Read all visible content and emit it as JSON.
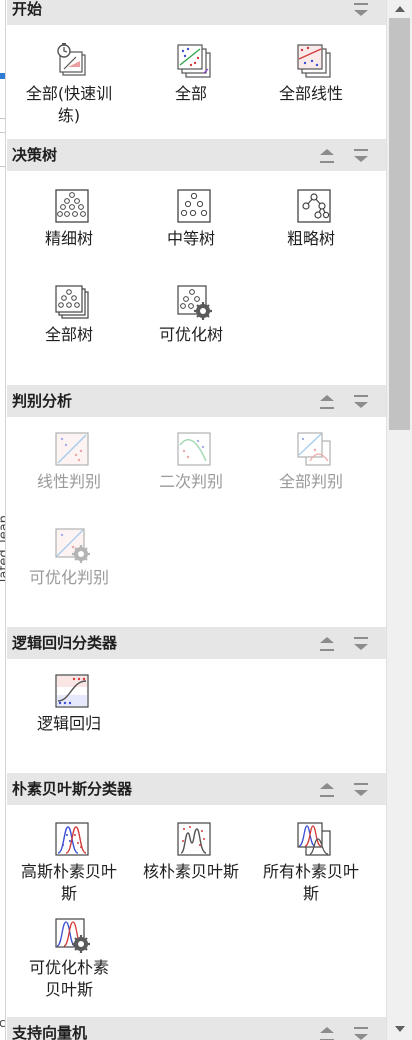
{
  "left_edge": {
    "vertical_text": "lated_lean",
    "bottom_char": "c"
  },
  "sections": [
    {
      "key": "start",
      "title": "开始",
      "tiles": [
        {
          "label": "全部(快速训练)",
          "icon": "fast-train-icon",
          "disabled": false
        },
        {
          "label": "全部",
          "icon": "all-models-icon",
          "disabled": false
        },
        {
          "label": "全部线性",
          "icon": "all-linear-icon",
          "disabled": false
        }
      ]
    },
    {
      "key": "tree",
      "title": "决策树",
      "tiles": [
        {
          "label": "精细树",
          "icon": "fine-tree-icon",
          "disabled": false
        },
        {
          "label": "中等树",
          "icon": "medium-tree-icon",
          "disabled": false
        },
        {
          "label": "粗略树",
          "icon": "coarse-tree-icon",
          "disabled": false
        },
        {
          "label": "全部树",
          "icon": "all-trees-icon",
          "disabled": false
        },
        {
          "label": "可优化树",
          "icon": "optimizable-tree-icon",
          "disabled": false
        }
      ]
    },
    {
      "key": "discriminant",
      "title": "判别分析",
      "tiles": [
        {
          "label": "线性判别",
          "icon": "linear-discriminant-icon",
          "disabled": true
        },
        {
          "label": "二次判别",
          "icon": "quadratic-discriminant-icon",
          "disabled": true
        },
        {
          "label": "全部判别",
          "icon": "all-discriminants-icon",
          "disabled": true
        },
        {
          "label": "可优化判别",
          "icon": "optimizable-discriminant-icon",
          "disabled": true
        }
      ]
    },
    {
      "key": "logistic",
      "title": "逻辑回归分类器",
      "tiles": [
        {
          "label": "逻辑回归",
          "icon": "logistic-regression-icon",
          "disabled": false
        }
      ]
    },
    {
      "key": "naive_bayes",
      "title": "朴素贝叶斯分类器",
      "tiles": [
        {
          "label": "高斯朴素贝叶斯",
          "icon": "gaussian-naive-bayes-icon",
          "disabled": false
        },
        {
          "label": "核朴素贝叶斯",
          "icon": "kernel-naive-bayes-icon",
          "disabled": false
        },
        {
          "label": "所有朴素贝叶斯",
          "icon": "all-naive-bayes-icon",
          "disabled": false
        },
        {
          "label": "可优化朴素贝叶斯",
          "icon": "optimizable-naive-bayes-icon",
          "disabled": false
        }
      ]
    },
    {
      "key": "svm",
      "title": "支持向量机",
      "tiles": []
    }
  ],
  "colors": {
    "header_bg": "#e6e6e6",
    "accent_blue": "#2f7bd6",
    "point_red": "#d43b3b",
    "point_blue": "#3b4fd4",
    "disabled_text": "#9a9a9a"
  }
}
